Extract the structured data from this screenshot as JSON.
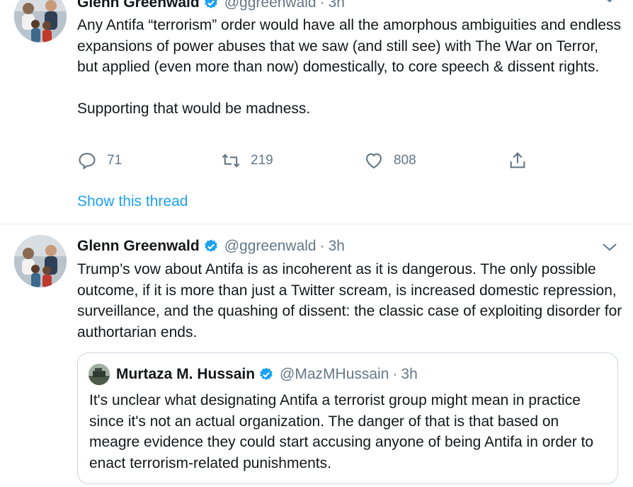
{
  "tweets": [
    {
      "author_name": "Glenn Greenwald",
      "handle": "@ggreenwald",
      "separator": "·",
      "time": "3h",
      "text": "Any Antifa “terrorism” order would have all the amorphous ambiguities and endless expansions of power abuses that we saw (and still see) with The War on Terror, but applied (even more than now) domestically, to core speech & dissent rights.\n\nSupporting that would be madness.",
      "replies": "71",
      "retweets": "219",
      "likes": "808",
      "show_thread": "Show this thread"
    },
    {
      "author_name": "Glenn Greenwald",
      "handle": "@ggreenwald",
      "separator": "·",
      "time": "3h",
      "text": "Trump’s vow about Antifa is as incoherent as it is dangerous. The only possible outcome, if it is more than just a Twitter scream, is increased domestic repression, surveillance, and the quashing of dissent: the classic case of exploiting disorder for authortarian ends.",
      "quote": {
        "author_name": "Murtaza M. Hussain",
        "handle": "@MazMHussain",
        "separator": "·",
        "time": "3h",
        "text": "It's unclear what designating Antifa a terrorist group might mean in practice since it's not an actual organization. The danger of that is that based on meagre evidence they could start accusing anyone of being Antifa in order to enact terrorism-related punishments."
      }
    }
  ],
  "colors": {
    "link_blue": "#1da1f2",
    "verified_blue": "#1da1f2",
    "muted_gray": "#657786",
    "divider": "#e6ecf0",
    "text": "#14171a"
  },
  "icons": {
    "reply": "speech-bubble-icon",
    "retweet": "retweet-arrows-icon",
    "like": "heart-icon",
    "share": "share-upload-icon",
    "menu": "chevron-down-icon",
    "verified": "verified-badge-icon"
  }
}
